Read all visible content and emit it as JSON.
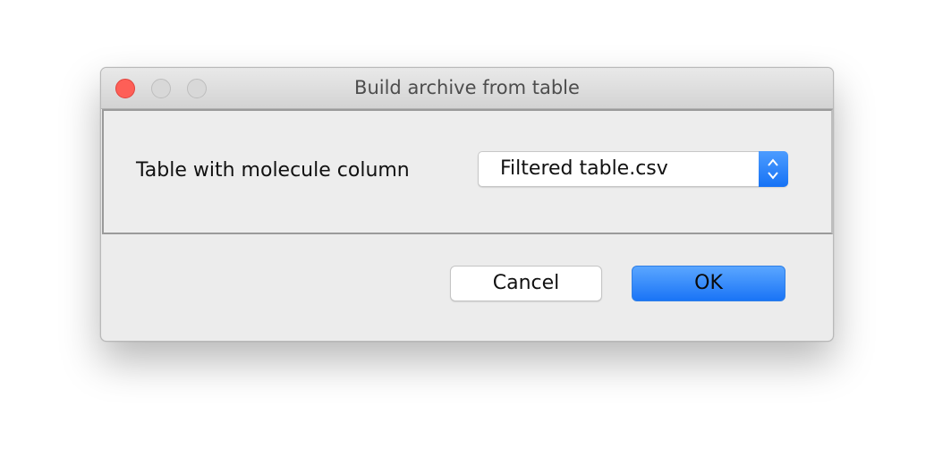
{
  "window": {
    "title": "Build archive from table"
  },
  "form": {
    "label": "Table with molecule column",
    "select_value": "Filtered table.csv"
  },
  "buttons": {
    "cancel": "Cancel",
    "ok": "OK"
  },
  "colors": {
    "accent": "#1a74f6",
    "close": "#fe5f57"
  }
}
